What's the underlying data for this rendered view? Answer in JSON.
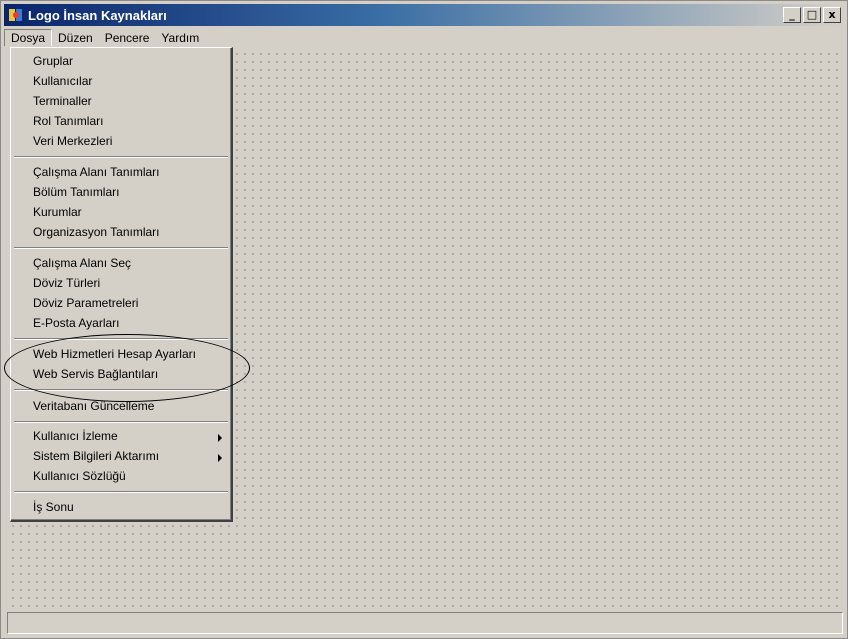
{
  "window": {
    "title": "Logo İnsan Kaynakları",
    "controls": [
      "_",
      "□",
      "x"
    ]
  },
  "menubar": [
    "Dosya",
    "Düzen",
    "Pencere",
    "Yardım"
  ],
  "dosya_menu": {
    "groups": [
      [
        "Gruplar",
        "Kullanıcılar",
        "Terminaller",
        "Rol Tanımları",
        "Veri Merkezleri"
      ],
      [
        "Çalışma Alanı Tanımları",
        "Bölüm Tanımları",
        "Kurumlar",
        "Organizasyon Tanımları"
      ],
      [
        "Çalışma Alanı Seç",
        "Döviz Türleri",
        "Döviz Parametreleri",
        "E-Posta Ayarları"
      ],
      [
        "Web Hizmetleri Hesap Ayarları",
        "Web Servis Bağlantıları"
      ],
      [
        "Veritabanı Güncelleme"
      ],
      [
        "Kullanıcı İzleme",
        "Sistem Bilgileri Aktarımı",
        "Kullanıcı Sözlüğü"
      ],
      [
        "İş Sonu"
      ]
    ],
    "submenu_items": [
      "Kullanıcı İzleme",
      "Sistem Bilgileri Aktarımı"
    ]
  },
  "colors": {
    "titlebar_start": "#0a246a",
    "titlebar_end": "#d4d0c8",
    "face": "#d4d0c8"
  }
}
